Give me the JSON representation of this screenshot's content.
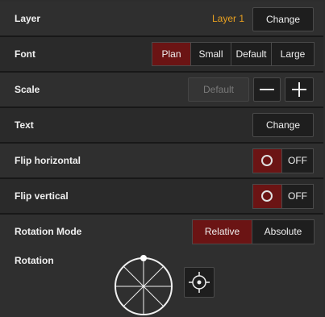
{
  "layer": {
    "label": "Layer",
    "value": "Layer 1",
    "change": "Change"
  },
  "font": {
    "label": "Font",
    "options": [
      "Plan",
      "Small",
      "Default",
      "Large"
    ],
    "selected": "Plan"
  },
  "scale": {
    "label": "Scale",
    "default_label": "Default",
    "minus_icon": "minus-icon",
    "plus_icon": "plus-icon"
  },
  "text": {
    "label": "Text",
    "change": "Change"
  },
  "flip_horizontal": {
    "label": "Flip horizontal",
    "state": "OFF"
  },
  "flip_vertical": {
    "label": "Flip vertical",
    "state": "OFF"
  },
  "rotation_mode": {
    "label": "Rotation Mode",
    "options": [
      "Relative",
      "Absolute"
    ],
    "selected": "Relative"
  },
  "rotation": {
    "label": "Rotation",
    "dial_icon": "rotation-dial-icon",
    "center_icon": "crosshair-icon"
  },
  "colors": {
    "accent": "#6b1414",
    "value": "#e8a020",
    "bg": "#2f2f2f"
  }
}
